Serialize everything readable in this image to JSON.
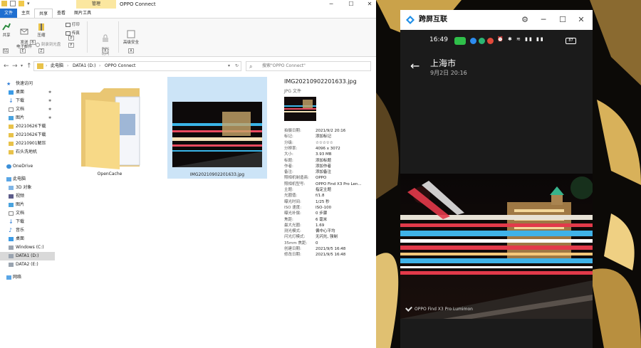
{
  "explorer": {
    "window_title": "OPPO Connect",
    "context_tab": "管理",
    "tabs": [
      "文件",
      "主页",
      "共享",
      "查看",
      "图片工具"
    ],
    "ribbon": {
      "share": "共享",
      "email": "发送\n电子邮件",
      "zip": "压缩",
      "print": "打印",
      "fax": "传真",
      "burn": "刻录到光盘",
      "remove_access": "删除\n访问",
      "advanced_security": "高级安全",
      "keys": [
        "S1",
        "E",
        "Z",
        "P",
        "F",
        "B",
        "R",
        "A"
      ]
    },
    "address": {
      "crumbs": [
        "此电脑",
        "DATA1 (D:)",
        "OPPO Connect"
      ],
      "search_placeholder": "搜索\"OPPO Connect\""
    },
    "nav": {
      "quick_access": "快速访问",
      "items": [
        "桌面",
        "下载",
        "文档",
        "图片",
        "20210626下载",
        "20210626下载",
        "20210901解压",
        "石头洗地机"
      ],
      "onedrive": "OneDrive",
      "this_pc": "此电脑",
      "pc_items": [
        "3D 对象",
        "视频",
        "图片",
        "文档",
        "下载",
        "音乐",
        "桌面",
        "Windows (C:)",
        "DATA1 (D:)",
        "DATA2 (E:)"
      ],
      "network": "网络"
    },
    "files": [
      {
        "name": "OpenCache",
        "type": "folder"
      },
      {
        "name": "IMG20210902201633.jpg",
        "type": "image"
      }
    ],
    "details": {
      "file_name": "IMG20210902201633.jpg",
      "file_type": "JPG 文件",
      "props": [
        {
          "k": "拍摄日期:",
          "v": "2021/9/2 20:16"
        },
        {
          "k": "标记:",
          "v": "添加标记"
        },
        {
          "k": "分级:",
          "v": "☆☆☆☆☆"
        },
        {
          "k": "分辨率:",
          "v": "4096 x 3072"
        },
        {
          "k": "大小:",
          "v": "3.93 MB"
        },
        {
          "k": "标题:",
          "v": "添加标题"
        },
        {
          "k": "作者:",
          "v": "添加作者"
        },
        {
          "k": "备注:",
          "v": "添加备注"
        },
        {
          "k": "照相机制造商:",
          "v": "OPPO"
        },
        {
          "k": "照相机型号:",
          "v": "OPPO Find X3 Pro Len..."
        },
        {
          "k": "主题:",
          "v": "指定主题"
        },
        {
          "k": "光圈值:",
          "v": "f/1.8"
        },
        {
          "k": "曝光时间:",
          "v": "1/25 秒"
        },
        {
          "k": "ISO 速度:",
          "v": "ISO-100"
        },
        {
          "k": "曝光补偿:",
          "v": "0 步骤"
        },
        {
          "k": "焦距:",
          "v": "6 毫米"
        },
        {
          "k": "最大光圈:",
          "v": "1.69"
        },
        {
          "k": "测光模式:",
          "v": "偏中心平均"
        },
        {
          "k": "闪光灯模式:",
          "v": "无闪光, 强制"
        },
        {
          "k": "35mm 焦距:",
          "v": "0"
        },
        {
          "k": "创建日期:",
          "v": "2021/9/5 16:48"
        },
        {
          "k": "修改日期:",
          "v": "2021/9/5 16:48"
        }
      ]
    }
  },
  "phone": {
    "app_name": "跨屏互联",
    "status_time": "16:49",
    "battery": "87",
    "location": "上海市",
    "datetime": "9月2日 20:16",
    "watermark": "OPPO Find X3 Pro Lumimon"
  },
  "colors": {
    "file_tab": "#1f6fd0",
    "selected_tile": "#cce4f7",
    "app_logo": "#1f8fe8"
  }
}
